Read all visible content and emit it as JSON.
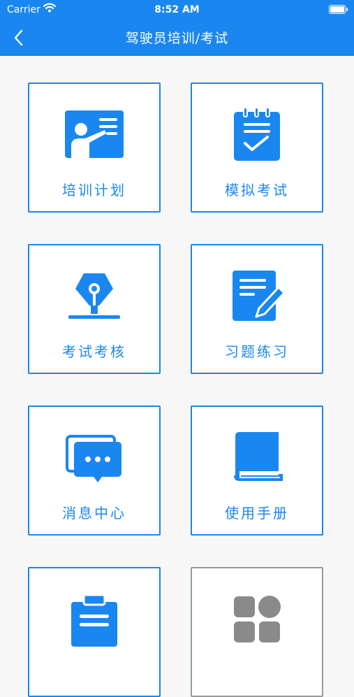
{
  "status_bar": {
    "carrier": "Carrier",
    "time": "8:52 AM"
  },
  "nav": {
    "title": "驾驶员培训/考试",
    "back_icon": "chevron-left-icon"
  },
  "colors": {
    "accent": "#1a87f0",
    "background": "#f7f7f7",
    "disabled": "#8a8a8a"
  },
  "tiles": [
    {
      "label": "培训计划",
      "icon": "presentation-board-icon"
    },
    {
      "label": "模拟考试",
      "icon": "notepad-check-icon"
    },
    {
      "label": "考试考核",
      "icon": "pen-nib-icon"
    },
    {
      "label": "习题练习",
      "icon": "edit-document-icon"
    },
    {
      "label": "消息中心",
      "icon": "chat-bubbles-icon"
    },
    {
      "label": "使用手册",
      "icon": "manual-book-icon"
    },
    {
      "label": "",
      "icon": "clipboard-icon"
    },
    {
      "label": "",
      "icon": "apps-grid-icon"
    }
  ]
}
